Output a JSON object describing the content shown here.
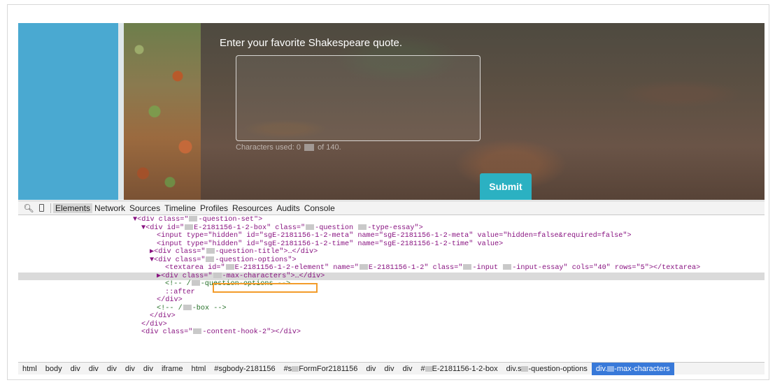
{
  "survey": {
    "question_title": "Enter your favorite Shakespeare quote.",
    "char_prefix": "Characters used: 0",
    "char_suffix": "of 140.",
    "submit_label": "Submit"
  },
  "devtools": {
    "tabs": [
      "Elements",
      "Network",
      "Sources",
      "Timeline",
      "Profiles",
      "Resources",
      "Audits",
      "Console"
    ],
    "active_tab": "Elements"
  },
  "code": {
    "l1_tag": "▼<div class=\"",
    "l1_rest": "-question-set\">",
    "l2a": "▼<div id=\"",
    "l2b": "E-2181156-1-2-box\" class=\"",
    "l2c": "-question ",
    "l2d": "-type-essay\">",
    "l3": "<input type=\"hidden\" id=\"sgE-2181156-1-2-meta\" name=\"sgE-2181156-1-2-meta\" value=\"hidden=false&required=false\">",
    "l4": "<input type=\"hidden\" id=\"sgE-2181156-1-2-time\" name=\"sgE-2181156-1-2-time\" value>",
    "l5a": "▶<div class=\"",
    "l5b": "-question-title\">…</div>",
    "l6a": "▼<div class=\"",
    "l6b": "-question-options\">",
    "l7a": "<textarea id=\"",
    "l7b": "E-2181156-1-2-element\" name=\"",
    "l7c": "E-2181156-1-2\" class=\"",
    "l7d": "-input ",
    "l7e": "-input-essay\" cols=\"40\" rows=\"5\"></textarea>",
    "l8a": "▶<div class=\"",
    "l8b": "-max-characters\">…</div>",
    "l9a": "<!-- /",
    "l9b": "-question-options -->",
    "l10": "::after",
    "l11": "</div>",
    "l12a": "<!-- /",
    "l12b": "-box -->",
    "l13": "</div>",
    "l14": "</div>",
    "l15a": "<div class=\"",
    "l15b": "-content-hook-2\"></div>"
  },
  "breadcrumbs": [
    "html",
    "body",
    "div",
    "div",
    "div",
    "div",
    "div",
    "iframe",
    "html",
    "#sgbody-2181156",
    "#s",
    "FormFor2181156",
    "div",
    "div",
    "div",
    "#",
    "E-2181156-1-2-box",
    "div.s",
    "-question-options",
    "div.",
    "-max-characters"
  ]
}
